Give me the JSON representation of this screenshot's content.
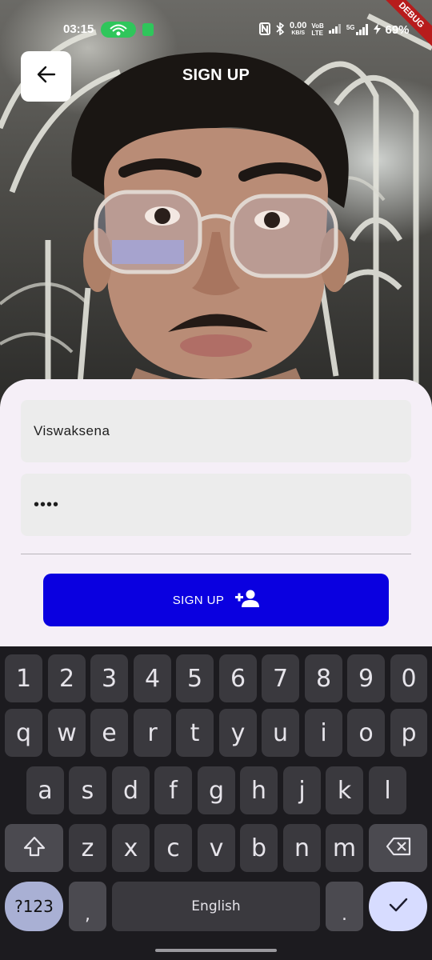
{
  "status_bar": {
    "time": "03:15",
    "network_speed_value": "0.00",
    "network_speed_unit": "KB/S",
    "volte_top": "VoB",
    "volte_bottom": "LTE",
    "signal_label": "5G",
    "battery_percent": "69%",
    "debug_banner": "DEBUG",
    "colors": {
      "hotspot": "#2fc65b",
      "debug": "#b71c1c"
    }
  },
  "app_bar": {
    "title": "SIGN UP",
    "back_icon": "arrow-back-icon"
  },
  "form": {
    "name_value": "Viswaksena",
    "password_value": "••••",
    "signup_label": "SIGN UP",
    "signup_icon": "person-add-icon",
    "colors": {
      "button": "#0a00e0",
      "sheet": "#f5eff7",
      "field": "#ececec"
    }
  },
  "keyboard": {
    "digits": [
      "1",
      "2",
      "3",
      "4",
      "5",
      "6",
      "7",
      "8",
      "9",
      "0"
    ],
    "row1": [
      "q",
      "w",
      "e",
      "r",
      "t",
      "y",
      "u",
      "i",
      "o",
      "p"
    ],
    "row2": [
      "a",
      "s",
      "d",
      "f",
      "g",
      "h",
      "j",
      "k",
      "l"
    ],
    "row3": [
      "z",
      "x",
      "c",
      "v",
      "b",
      "n",
      "m"
    ],
    "symbols_label": "?123",
    "comma_label": ",",
    "space_label": "English",
    "period_label": ".",
    "shift_icon": "shift-icon",
    "backspace_icon": "backspace-icon",
    "enter_icon": "checkmark-icon",
    "colors": {
      "background": "#1c1b1f",
      "key": "#3a393e",
      "symbols": "#a9b0d4",
      "enter": "#d7dcff"
    }
  }
}
